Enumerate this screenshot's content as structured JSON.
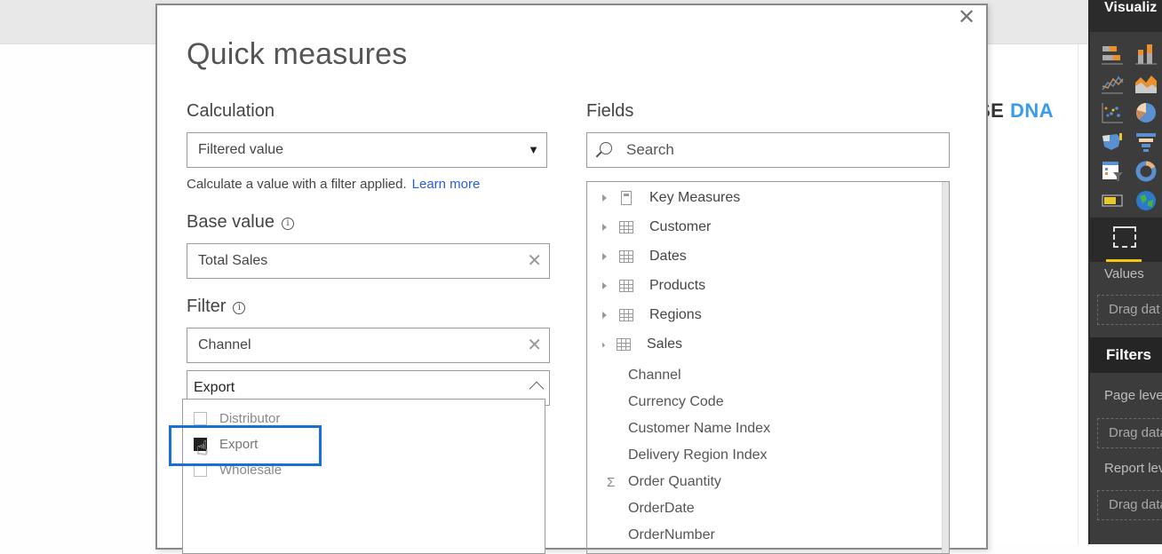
{
  "background": {
    "logo": {
      "dark_part": "SE",
      "blue_part": "DNA"
    }
  },
  "right_pane": {
    "title": "Visualiz",
    "visual_icons": [
      "stacked-bar-chart-icon",
      "stacked-column-chart-icon",
      "line-chart-icon",
      "area-chart-icon",
      "scatter-chart-icon",
      "pie-chart-icon",
      "filled-map-icon",
      "funnel-chart-icon",
      "slicer-icon",
      "donut-chart-icon",
      "card-icon",
      "globe-map-icon"
    ],
    "values_label": "Values",
    "values_drag": "Drag dat",
    "filters_title": "Filters",
    "page_level": "Page leve",
    "page_drag": "Drag data",
    "report_level": "Report lev",
    "report_drag": "Drag data"
  },
  "dialog": {
    "title": "Quick measures",
    "close_glyph": "✕",
    "calculation": {
      "label": "Calculation",
      "value": "Filtered value",
      "caret": "▼",
      "help": "Calculate a value with a filter applied.",
      "learn_more": "Learn more"
    },
    "base_value": {
      "label": "Base value",
      "info": "i",
      "value": "Total Sales",
      "clear": "✕"
    },
    "filter": {
      "label": "Filter",
      "info": "i",
      "field_value": "Channel",
      "clear": "✕",
      "selected_value": "Export",
      "options": [
        {
          "label": "Distributor",
          "checked": false
        },
        {
          "label": "Export",
          "checked": true
        },
        {
          "label": "Wholesale",
          "checked": false
        }
      ]
    },
    "fields": {
      "label": "Fields",
      "search_placeholder": "Search",
      "tables": [
        {
          "name": "Key Measures",
          "icon": "calculator-icon",
          "expanded": false
        },
        {
          "name": "Customer",
          "icon": "table-icon",
          "expanded": false
        },
        {
          "name": "Dates",
          "icon": "table-icon",
          "expanded": false
        },
        {
          "name": "Products",
          "icon": "table-icon",
          "expanded": false
        },
        {
          "name": "Regions",
          "icon": "table-icon",
          "expanded": false
        },
        {
          "name": "Sales",
          "icon": "table-icon",
          "expanded": true
        }
      ],
      "sales_columns": [
        {
          "name": "Channel",
          "sigma": false
        },
        {
          "name": "Currency Code",
          "sigma": false
        },
        {
          "name": "Customer Name Index",
          "sigma": false
        },
        {
          "name": "Delivery Region Index",
          "sigma": false
        },
        {
          "name": "Order Quantity",
          "sigma": true
        },
        {
          "name": "OrderDate",
          "sigma": false
        },
        {
          "name": "OrderNumber",
          "sigma": false
        }
      ]
    }
  }
}
